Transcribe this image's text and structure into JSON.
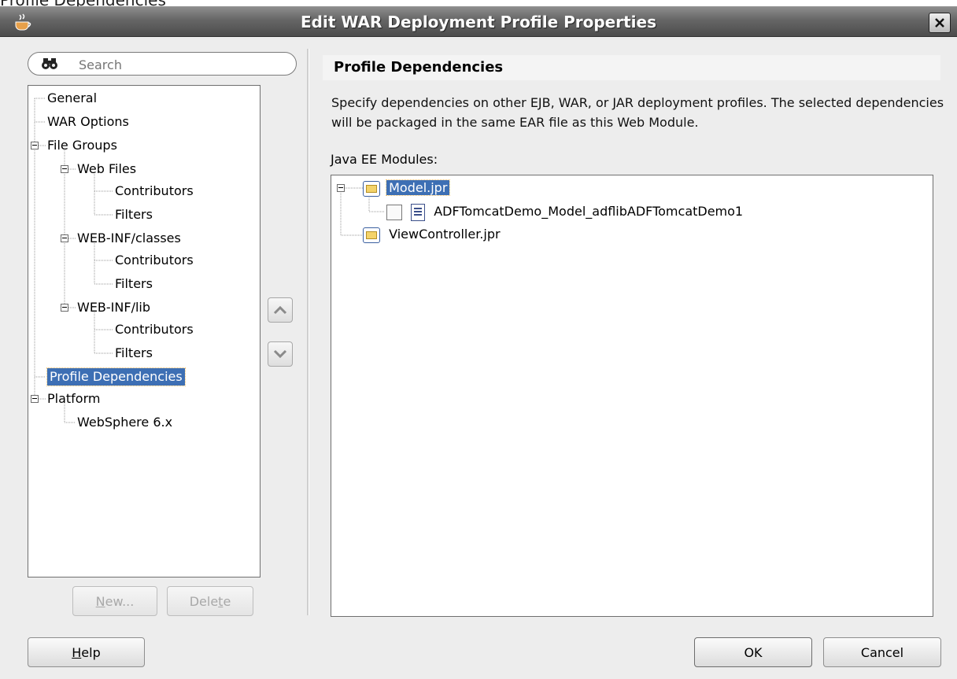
{
  "window": {
    "top_strip_text": "Profile Dependencies",
    "title": "Edit WAR Deployment Profile Properties",
    "close_label": "×"
  },
  "search": {
    "placeholder": "Search"
  },
  "nav_tree": {
    "items": [
      {
        "label": "General"
      },
      {
        "label": "WAR Options"
      },
      {
        "label": "File Groups"
      },
      {
        "label": "Web Files"
      },
      {
        "label": "Contributors"
      },
      {
        "label": "Filters"
      },
      {
        "label": "WEB-INF/classes"
      },
      {
        "label": "Contributors"
      },
      {
        "label": "Filters"
      },
      {
        "label": "WEB-INF/lib"
      },
      {
        "label": "Contributors"
      },
      {
        "label": "Filters"
      },
      {
        "label": "Profile Dependencies",
        "selected": true
      },
      {
        "label": "Platform"
      },
      {
        "label": "WebSphere 6.x"
      }
    ]
  },
  "nav_buttons": {
    "new_label": "New...",
    "new_mnemonic": "N",
    "new_rest": "ew...",
    "delete_prefix": "Dele",
    "delete_mnemonic": "t",
    "delete_rest": "e"
  },
  "panel": {
    "title": "Profile Dependencies",
    "description": "Specify dependencies on other EJB, WAR, or JAR deployment profiles.  The selected dependencies will be packaged in the same EAR file as this Web Module.",
    "modules_label_mnemonic": "J",
    "modules_label_rest": "ava EE Modules:"
  },
  "modules_tree": {
    "items": [
      {
        "label": "Model.jpr",
        "selected": true
      },
      {
        "label": "ADFTomcatDemo_Model_adflibADFTomcatDemo1",
        "checked": false
      },
      {
        "label": "ViewController.jpr"
      }
    ]
  },
  "footer": {
    "help_mnemonic": "H",
    "help_rest": "elp",
    "ok_label": "OK",
    "cancel_label": "Cancel"
  },
  "colors": {
    "selection": "#3d6fb4",
    "dialog_background": "#ededed",
    "titlebar": "#5e5e5e"
  }
}
